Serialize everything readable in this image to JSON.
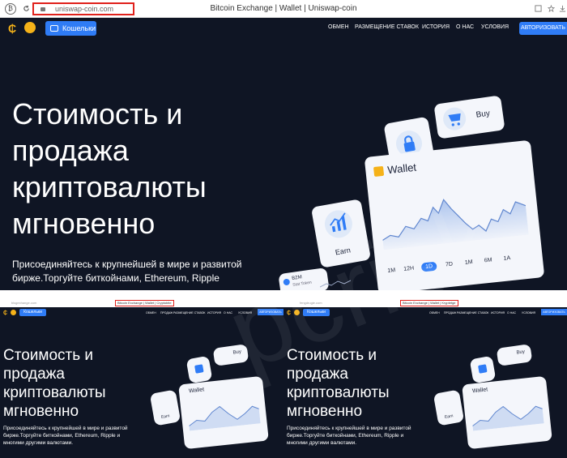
{
  "browser": {
    "url": "uniswap-coin.com",
    "tab_title": "Bitcoin Exchange | Wallet | Uniswap-coin"
  },
  "site": {
    "wallets_button": "Кошельки",
    "menu": [
      "ОБМЕН",
      "РАЗМЕЩЕНИЕ СТАВОК",
      "ИСТОРИЯ",
      "О НАС",
      "УСЛОВИЯ"
    ],
    "auth_button": "АВТОРИЗОВАТЬ",
    "hero_title": "Стоимость и продажа криптовалюты мгновенно",
    "hero_subtitle": "Присоединяйтесь к крупнейшей в мире и развитой бирже.Торгуйте биткойнами, Ethereum, Ripple",
    "cards": {
      "buy": "Buy",
      "wallet": "Wallet",
      "earn": "Earn",
      "time_ranges": [
        "1M",
        "12H",
        "1D",
        "7D",
        "1M",
        "6M",
        "1A"
      ],
      "active_range": "1D",
      "coin_label": "BZM",
      "coin_sub": "Stat Token"
    }
  },
  "thumbnails": [
    {
      "url": "blsgexhange.com",
      "tab_title": "Bitcoin Exchange | Wallet | Cryptobite",
      "wallets_button": "Кошельки",
      "menu": [
        "ОБМЕН",
        "ПРОДАЖ",
        "РАЗМЕЩЕНИЕ СТАВОК",
        "ИСТОРИЯ",
        "О НАС",
        "УСЛОВИЯ"
      ],
      "auth_button": "АВТОРИЗОВАТЬ",
      "hero_title": "Стоимость и продажа криптовалюты мгновенно",
      "hero_subtitle": "Присоединяйтесь к крупнейшей в мире и развитой бирже.Торгуйте биткойнами, Ethereum, Ripple и многими другими валютами.",
      "buy": "Buy",
      "wallet": "Wallet",
      "earn": "Earn"
    },
    {
      "url": "fengdrugie.com",
      "tab_title": "Bitcoin Exchange | Wallet | Kryptetge",
      "wallets_button": "Кошельки",
      "menu": [
        "ОБМЕН",
        "ПРОДАЖ",
        "РАЗМЕЩЕНИЕ СТАВОК",
        "ИСТОРИЯ",
        "О НАС",
        "УСЛОВИЯ"
      ],
      "auth_button": "АВТОРИЗОВАТЬ",
      "hero_title": "Стоимость и продажа криптовалюты мгновенно",
      "hero_subtitle": "Присоединяйтесь к крупнейшей в мире и развитой бирже.Торгуйте биткойнами, Ethereum, Ripple и многими другими валютами.",
      "buy": "Buy",
      "wallet": "Wallet",
      "earn": "Earn"
    }
  ],
  "watermark_text": "pcrisk",
  "colors": {
    "background": "#0f1524",
    "accent": "#2f7cf6",
    "logo": "#f5b219",
    "highlight": "#e0211b"
  }
}
